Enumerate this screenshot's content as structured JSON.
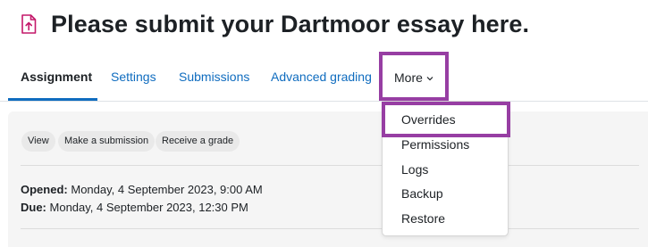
{
  "page": {
    "title": "Please submit your Dartmoor essay here."
  },
  "icons": {
    "page_icon": "assignment-upload-icon",
    "more_chevron": "chevron-down-icon"
  },
  "colors": {
    "accent": "#0f6cbf",
    "highlight": "#973ea3",
    "assignment_icon": "#c4186a",
    "content_bg": "#f5f5f5"
  },
  "tabs": {
    "assignment": "Assignment",
    "settings": "Settings",
    "submissions": "Submissions",
    "advanced_grading": "Advanced grading",
    "more": "More",
    "active": "Assignment"
  },
  "activity": {
    "actions": {
      "view": "View",
      "make_submission": "Make a submission",
      "receive_grade": "Receive a grade"
    },
    "opened_label": "Opened:",
    "opened_value": "Monday, 4 September 2023, 9:00 AM",
    "due_label": "Due:",
    "due_value": "Monday, 4 September 2023, 12:30 PM"
  },
  "more_menu": {
    "items": [
      "Overrides",
      "Permissions",
      "Logs",
      "Backup",
      "Restore"
    ]
  }
}
